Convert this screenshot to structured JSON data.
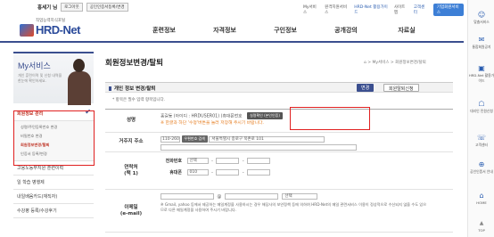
{
  "topbar": {
    "user_name": "홍세기 님",
    "logout": "로그아웃",
    "cert_link": "공인인증서등록/변경",
    "links": [
      "My서비스",
      "원격지원서비스",
      "HRD-Net 활용가이드",
      "사이트맵",
      "고객센터"
    ],
    "enterprise": "기업회원서비스"
  },
  "logo": {
    "tagline": "직업능력지식포털",
    "name": "HRD-Net"
  },
  "gnb": [
    "훈련정보",
    "자격정보",
    "구인정보",
    "공개강의",
    "자료실"
  ],
  "sidebar": {
    "title": "My서비스",
    "desc": "개인 훈련이력 및 신청 내역을 한눈에 확인하세요.",
    "menu": [
      {
        "label": "회원정보 관리",
        "active": true
      },
      {
        "label": "고용노동부지원 훈련이력"
      },
      {
        "label": "일 학습 병행제"
      },
      {
        "label": "내일배움카드(재직자)"
      },
      {
        "label": "수강평 등록/수강후기"
      }
    ],
    "submenu": [
      "성명/주민등록번호 변경",
      "비밀번호 변경",
      "회원정보변경/탈퇴",
      "인증서 등록/변경"
    ],
    "submenu_active_index": 2
  },
  "main": {
    "title": "회원정보변경/탈퇴",
    "breadcrumb": "⌂ > My서비스 > 회원정보변경/탈퇴",
    "section_title": "개인 정보 변경/탈퇴",
    "tab_edit": "변경",
    "tab_leave": "회원탈퇴신청",
    "required_note": "* 항목은 필수 입력 항목입니다.",
    "name_label": "성명",
    "name_value": "홍길동 (아이디 : HRDUSER01) (휴대폰번호",
    "verify_btn": "실명확인 (본인인증)",
    "name_warn": "※ 한글과 하단 '수정'버튼을 눌러 저장해 주시기 바랍니다.",
    "addr_label": "거주지 주소",
    "zip": "110-260",
    "zip_btn": "우편번호 검색",
    "addr1": "서울특별시 종로구 북촌로 101",
    "contact_label": "연락처\n(택 1)",
    "phone_label": "전화번호",
    "mobile_label": "휴대폰",
    "phone_select": "선택",
    "mobile_select": "010",
    "email_label": "이메일\n(e-mail)",
    "email_select": "선택",
    "email_note": "※ Gmail, yahoo 등에서 제공하는 메일계정을 사용하시는 경우 해당사의 보안정책 등에 의하여 HRD-Net의 메일 관련서비스 이용이 정상적으로 수신되지 않을 수도 있으므로 다른 메일계정을 사용하여 주시기 바랍니다."
  },
  "quick": [
    "맞춤서비스",
    "통합회원공지",
    "HRD-Net 활용가이드",
    "대리인 민원신청",
    "고객센터",
    "공인인증서 안내",
    "HOME",
    "TOP"
  ]
}
